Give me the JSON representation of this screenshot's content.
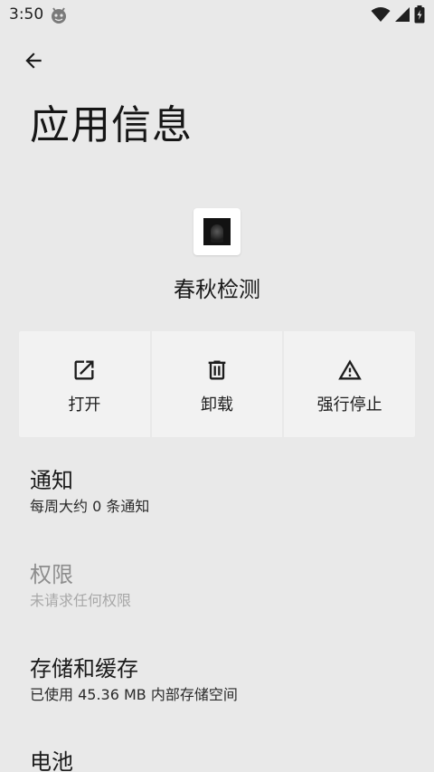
{
  "status_bar": {
    "time": "3:50",
    "left_icon": "android-debug-icon",
    "right_icons": [
      "wifi-icon",
      "cellular-signal-icon",
      "battery-charging-icon"
    ]
  },
  "header": {
    "back_icon": "arrow-back-icon",
    "title": "应用信息"
  },
  "app": {
    "name": "春秋检测",
    "icon": "app-icon"
  },
  "actions": [
    {
      "label": "打开",
      "icon": "open-in-new-icon"
    },
    {
      "label": "卸载",
      "icon": "trash-icon"
    },
    {
      "label": "强行停止",
      "icon": "warning-icon"
    }
  ],
  "settings": [
    {
      "title": "通知",
      "subtitle": "每周大约 0 条通知",
      "enabled": true
    },
    {
      "title": "权限",
      "subtitle": "未请求任何权限",
      "enabled": false
    },
    {
      "title": "存储和缓存",
      "subtitle": "已使用 45.36 MB 内部存储空间",
      "enabled": true
    },
    {
      "title": "电池",
      "enabled": true
    }
  ],
  "colors": {
    "background": "#e9e9e9",
    "button_background": "#f2f2f2",
    "disabled_text": "#8e8e8e"
  }
}
